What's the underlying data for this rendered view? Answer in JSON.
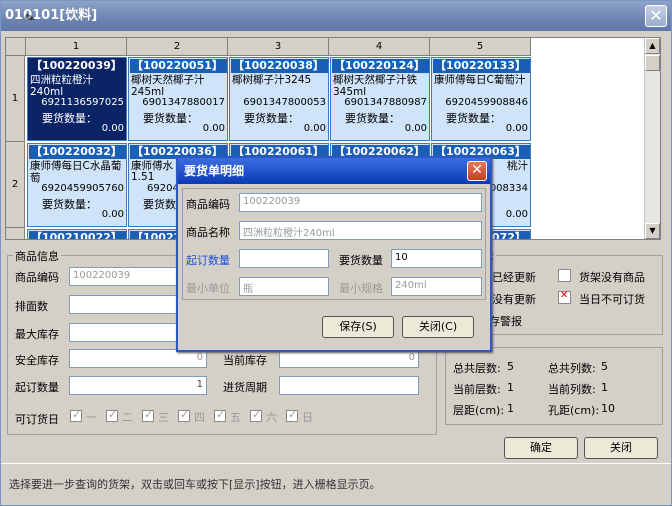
{
  "window": {
    "title": "010101[饮料]"
  },
  "grid": {
    "columns": [
      "1",
      "2",
      "3",
      "4",
      "5"
    ],
    "rows": [
      "1",
      "2"
    ],
    "cells": [
      [
        {
          "code": "【100220039】",
          "name": "四洲粒粒橙汁240ml",
          "barcode": "6921136597025",
          "qty_label": "要货数量：",
          "qty": "0.00",
          "selected": true
        },
        {
          "code": "【100220051】",
          "name": "椰树天然椰子汁245ml",
          "barcode": "6901347880017",
          "qty_label": "要货数量：",
          "qty": "0.00"
        },
        {
          "code": "【100220038】",
          "name": "椰树椰子汁3245",
          "barcode": "6901347800053",
          "qty_label": "要货数量：",
          "qty": "0.00"
        },
        {
          "code": "【100220124】",
          "name": "椰树天然椰子汁铁345ml",
          "barcode": "6901347880987",
          "qty_label": "要货数量：",
          "qty": "0.00"
        },
        {
          "code": "【100220133】",
          "name": "康师傅每日C葡萄汁",
          "barcode": "6920459908846",
          "qty_label": "要货数量：",
          "qty": "0.00"
        }
      ],
      [
        {
          "code": "【100220032】",
          "name": "康师傅每日C水晶葡萄",
          "barcode": "6920459905760",
          "qty_label": "要货数量：",
          "qty": "0.00"
        },
        {
          "code": "【100220036】",
          "name": "康师傅水",
          "barcode": "69204",
          "qty_label": "要货数量：",
          "qty": "0.00",
          "extra": "1.51"
        },
        {
          "code": "【100220061】",
          "name": "",
          "barcode": "",
          "qty_label": "",
          "qty": ""
        },
        {
          "code": "【100220062】",
          "name": "",
          "barcode": "",
          "qty_label": "",
          "qty": ""
        },
        {
          "code": "【100220063】",
          "name": "桃汁",
          "barcode": "008334",
          "qty_label": "",
          "qty": "0.00"
        }
      ]
    ],
    "partial_row": [
      "【100210022】",
      "【10022",
      "",
      "",
      "【100220072】"
    ]
  },
  "product_info": {
    "title": "商品信息",
    "code_label": "商品编码",
    "code_value": "100220039",
    "rows_label": "排面数",
    "max_stock_label": "最大库存",
    "safe_stock_label": "安全库存",
    "safe_stock_value": "0",
    "current_stock_label": "当前库存",
    "current_stock_value": "0",
    "min_order_label": "起订数量",
    "min_order_value": "1",
    "cycle_label": "进货周期",
    "order_days_label": "可订货日",
    "days": [
      "一",
      "二",
      "三",
      "四",
      "五",
      "六",
      "日"
    ]
  },
  "right_panel": {
    "title": "示",
    "shelf_updated": "架已经更新",
    "no_product": "货架没有商品",
    "not_updated": "架没有更新",
    "no_order_today": "当日不可订货",
    "stock_warning": "存警报",
    "total_layers_label": "总共层数:",
    "total_layers": "5",
    "total_cols_label": "总共列数:",
    "total_cols": "5",
    "cur_layer_label": "当前层数:",
    "cur_layer": "1",
    "cur_col_label": "当前列数:",
    "cur_col": "1",
    "layer_gap_label": "层距(cm):",
    "layer_gap": "1",
    "hole_gap_label": "孔距(cm):",
    "hole_gap": "10"
  },
  "buttons": {
    "ok": "确定",
    "close": "关闭"
  },
  "status": "选择要进一步查询的货架，双击或回车或按下[显示]按钮，进入栅格显示页。",
  "dialog": {
    "title": "要货单明细",
    "code_label": "商品编码",
    "code_value": "100220039",
    "name_label": "商品名称",
    "name_value": "四洲粒粒橙汁240ml",
    "min_order_label": "起订数量",
    "min_order_value": "",
    "order_qty_label": "要货数量",
    "order_qty_value": "10",
    "min_unit_label": "最小单位",
    "min_unit_value": "瓶",
    "min_spec_label": "最小规格",
    "min_spec_value": "240ml",
    "save_label": "保存(S)",
    "close_label": "关闭(C)"
  }
}
